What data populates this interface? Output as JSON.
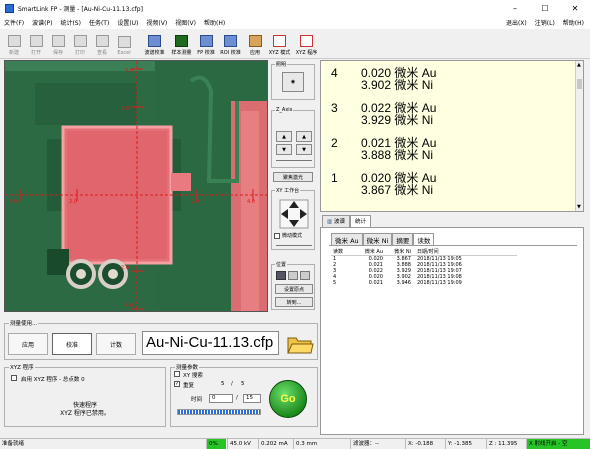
{
  "window": {
    "title": "SmartLink FP - 测量 - [Au-Ni-Cu-11.13.cfp]",
    "min": "–",
    "max": "☐",
    "close": "✕"
  },
  "menu": {
    "items": [
      "文件(F)",
      "波谱(P)",
      "统计(S)",
      "任务(T)",
      "设置(U)",
      "视频(V)",
      "视图(V)",
      "帮助(H)"
    ],
    "right": [
      "退出(X)",
      "注销(L)",
      "帮助(H)"
    ]
  },
  "toolbar": {
    "buttons": [
      {
        "label": "新建",
        "enabled": false
      },
      {
        "label": "打开",
        "enabled": false
      },
      {
        "label": "保存",
        "enabled": false
      },
      {
        "label": "打印",
        "enabled": false
      },
      {
        "label": "查看",
        "enabled": false
      },
      {
        "label": "Excel",
        "enabled": false
      },
      {
        "label": "波谱校准",
        "enabled": true
      },
      {
        "label": "样本测量",
        "enabled": true
      },
      {
        "label": "FP 校准",
        "enabled": true
      },
      {
        "label": "ROI 校准",
        "enabled": true
      },
      {
        "label": "应用",
        "enabled": true
      },
      {
        "label": "XYZ 模式",
        "enabled": true
      },
      {
        "label": "XYZ 程序",
        "enabled": true
      }
    ]
  },
  "video": {
    "ticks_y": [
      "4.0",
      "2.0",
      "2.0",
      "4.0"
    ],
    "ticks_x": [
      "4.0",
      "2.0",
      "2.0",
      "4.0"
    ]
  },
  "side": {
    "lighting": "照明",
    "z_axis": "Z_Axis",
    "focus_btn": "聚焦激光",
    "xy_table": "XY 工作台",
    "jog": "微动模式",
    "position": "位置",
    "set_origin": "设置原点",
    "goto": "转到..."
  },
  "readings": [
    {
      "n": "4",
      "au": "0.020 微米 Au",
      "ni": "3.902 微米 Ni"
    },
    {
      "n": "3",
      "au": "0.022 微米 Au",
      "ni": "3.929 微米 Ni"
    },
    {
      "n": "2",
      "au": "0.021 微米 Au",
      "ni": "3.888 微米 Ni"
    },
    {
      "n": "1",
      "au": "0.020 微米 Au",
      "ni": "3.867 微米 Ni"
    }
  ],
  "tabs_top": [
    "波谱",
    "统计"
  ],
  "tabs_stats": [
    "微米 Au",
    "微米 Ni",
    "摘要",
    "读数"
  ],
  "table": {
    "headers": [
      "读数",
      "微米 Au",
      "微米 Ni",
      "日期/时间"
    ],
    "rows": [
      [
        "1",
        "0.020",
        "3.867",
        "2018/11/13 19:05"
      ],
      [
        "2",
        "0.021",
        "3.888",
        "2018/11/13 19:06"
      ],
      [
        "3",
        "0.022",
        "3.929",
        "2018/11/13 19:07"
      ],
      [
        "4",
        "0.020",
        "3.902",
        "2018/11/13 19:08"
      ],
      [
        "5",
        "0.021",
        "3.946",
        "2018/11/13 19:09"
      ]
    ]
  },
  "measure": {
    "label": "测量使用...",
    "btn_apply": "应用",
    "btn_calib": "校准",
    "btn_count": "计数",
    "file": "Au-Ni-Cu-11.13.cfp"
  },
  "xyz": {
    "label": "XYZ 程序",
    "enable": "启用 XYZ 程序 - 总点数 0",
    "quick1": "快速程序",
    "quick2": "XYZ 程序已禁用。"
  },
  "params": {
    "label": "测量参数",
    "xy_search": "XY 搜索",
    "repeat": "重复",
    "rep_done": "5",
    "rep_sep": "/",
    "rep_total": "5",
    "time": "时间",
    "time_val": "0",
    "time_total": "15",
    "go": "Go"
  },
  "status": {
    "ready": "准备就绪",
    "pct": "0%",
    "kv": "45.0 kV",
    "ma": "0.202 mA",
    "mm": "0.3 mm",
    "filter": "滤波器：--",
    "x": "X: -0.188",
    "y": "Y: -1.385",
    "z": "Z : 11.395",
    "shutter": "X 射线开启 - 空"
  }
}
